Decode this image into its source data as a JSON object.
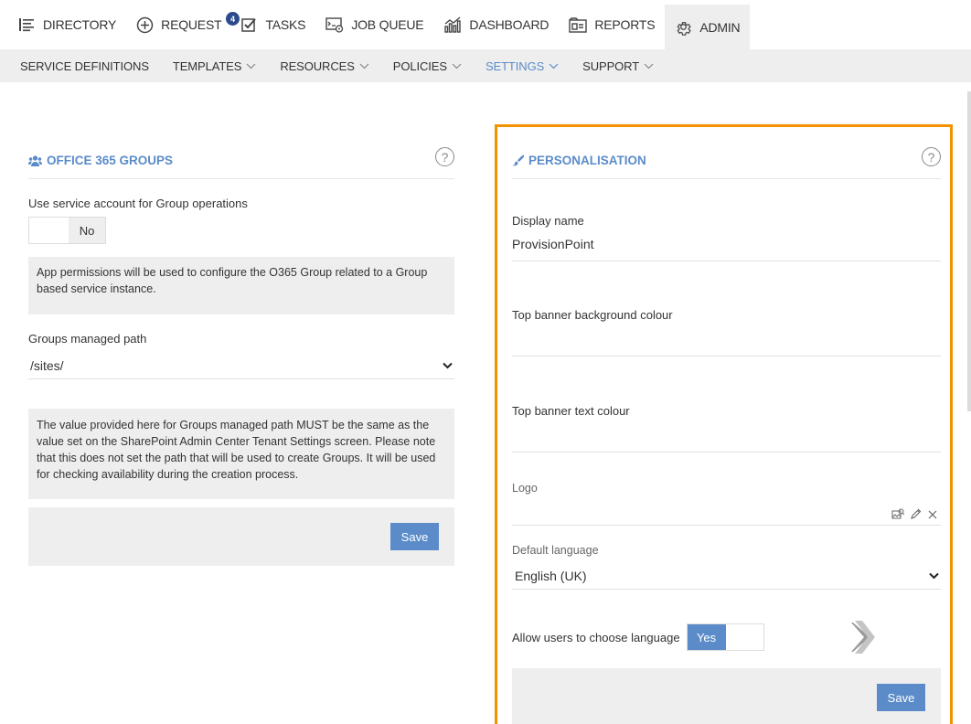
{
  "topnav": {
    "tabs": [
      {
        "label": "DIRECTORY",
        "icon": "list-icon"
      },
      {
        "label": "REQUEST",
        "icon": "plus-circle-icon"
      },
      {
        "label": "TASKS",
        "icon": "checkbox-icon",
        "badge": "4"
      },
      {
        "label": "JOB QUEUE",
        "icon": "job-queue-icon"
      },
      {
        "label": "DASHBOARD",
        "icon": "bar-chart-icon"
      },
      {
        "label": "REPORTS",
        "icon": "reports-icon"
      },
      {
        "label": "ADMIN",
        "icon": "gear-icon",
        "active": true
      }
    ]
  },
  "subnav": {
    "items": [
      {
        "label": "SERVICE DEFINITIONS",
        "has_chevron": false
      },
      {
        "label": "TEMPLATES",
        "has_chevron": true
      },
      {
        "label": "RESOURCES",
        "has_chevron": true
      },
      {
        "label": "POLICIES",
        "has_chevron": true
      },
      {
        "label": "SETTINGS",
        "has_chevron": true,
        "active": true
      },
      {
        "label": "SUPPORT",
        "has_chevron": true
      }
    ]
  },
  "office365": {
    "title": "OFFICE 365 GROUPS",
    "help": "?",
    "service_account_label": "Use service account for Group operations",
    "service_account_value": "No",
    "service_account_info": "App permissions will be used to configure the O365 Group related to a Group based service instance.",
    "managed_path_label": "Groups managed path",
    "managed_path_value": "/sites/",
    "managed_path_info": "The value provided here for Groups managed path MUST be the same as the value set on the SharePoint Admin Center Tenant Settings screen. Please note that this does not set the path that will be used to create Groups. It will be used for checking availability during the creation process.",
    "save_label": "Save"
  },
  "personalisation": {
    "title": "PERSONALISATION",
    "help": "?",
    "display_name_label": "Display name",
    "display_name_value": "ProvisionPoint",
    "banner_bg_label": "Top banner background colour",
    "banner_bg_value": "",
    "banner_text_label": "Top banner text colour",
    "banner_text_value": "",
    "logo_label": "Logo",
    "default_language_label": "Default language",
    "default_language_value": "English (UK)",
    "allow_language_label": "Allow users to choose language",
    "allow_language_value": "Yes",
    "save_label": "Save"
  },
  "colors": {
    "accent": "#5b8cc9",
    "highlight_border": "#f39200",
    "badge": "#2b4b8c",
    "nav_bg": "#eeeeee"
  }
}
